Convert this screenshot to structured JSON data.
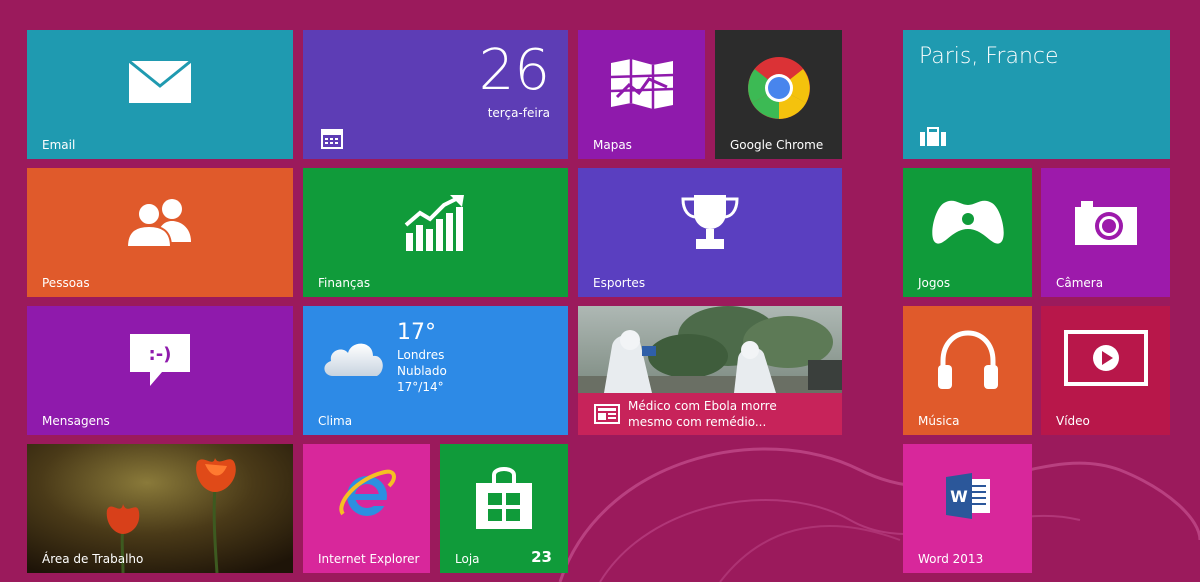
{
  "tiles": {
    "email": {
      "label": "Email",
      "color": "#1f9ab0"
    },
    "calendar": {
      "day_number": "26",
      "weekday": "terça-feira",
      "color": "#5d3db5"
    },
    "maps": {
      "label": "Mapas",
      "color": "#8f1aac"
    },
    "chrome": {
      "label": "Google Chrome",
      "color": "#2c2c2c"
    },
    "travel": {
      "city": "Paris, France",
      "color": "#1f9ab0"
    },
    "people": {
      "label": "Pessoas",
      "color": "#e05a2b"
    },
    "finance": {
      "label": "Finanças",
      "color": "#109b3a"
    },
    "sports": {
      "label": "Esportes",
      "color": "#5a3fc0"
    },
    "games": {
      "label": "Jogos",
      "color": "#109b3a"
    },
    "camera": {
      "label": "Câmera",
      "color": "#9d1aab"
    },
    "messaging": {
      "label": "Mensagens",
      "color": "#8f1aac"
    },
    "weather": {
      "label": "Clima",
      "temp": "17°",
      "city": "Londres",
      "condition": "Nublado",
      "range": "17°/14°",
      "color": "#2d8ae6"
    },
    "news": {
      "headline_1": "Médico com Ebola morre",
      "headline_2": "mesmo com remédio...",
      "color": "#c7235a"
    },
    "music": {
      "label": "Música",
      "color": "#e05a2b"
    },
    "video": {
      "label": "Vídeo",
      "color": "#b8174a"
    },
    "desktop": {
      "label": "Área de Trabalho"
    },
    "ie": {
      "label": "Internet Explorer",
      "color": "#d8279b"
    },
    "store": {
      "label": "Loja",
      "badge": "23",
      "color": "#109b3a"
    },
    "word": {
      "label": "Word 2013",
      "color": "#d8279b"
    }
  },
  "icons": {
    "email": "mail-icon",
    "calendar": "calendar-icon",
    "maps": "map-icon",
    "chrome": "chrome-logo-icon",
    "travel": "suitcase-icon",
    "people": "people-icon",
    "finance": "chart-icon",
    "sports": "trophy-icon",
    "games": "gamepad-icon",
    "camera": "camera-icon",
    "messaging": "message-bubble-icon",
    "weather": "cloud-icon",
    "news": "newspaper-icon",
    "music": "headphones-icon",
    "video": "play-icon",
    "ie": "internet-explorer-icon",
    "store": "store-bag-icon",
    "word": "word-icon"
  }
}
